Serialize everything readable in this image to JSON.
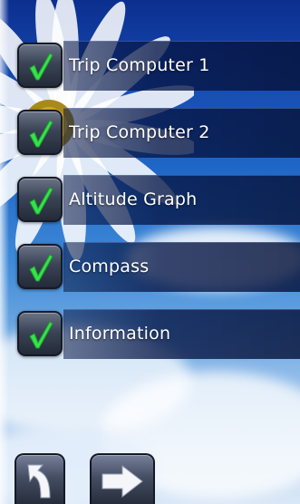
{
  "menu": {
    "items": [
      {
        "label": "Trip Computer 1",
        "checked": true
      },
      {
        "label": "Trip Computer 2",
        "checked": true
      },
      {
        "label": "Altitude Graph",
        "checked": true
      },
      {
        "label": "Compass",
        "checked": true
      },
      {
        "label": "Information",
        "checked": true
      }
    ]
  },
  "footer": {
    "back_icon": "back-arrow-icon",
    "next_icon": "forward-arrow-icon"
  },
  "colors": {
    "check_mark": "#35e24a",
    "row_bar": "#0a1a50",
    "sky_top": "#0b2f8f"
  }
}
